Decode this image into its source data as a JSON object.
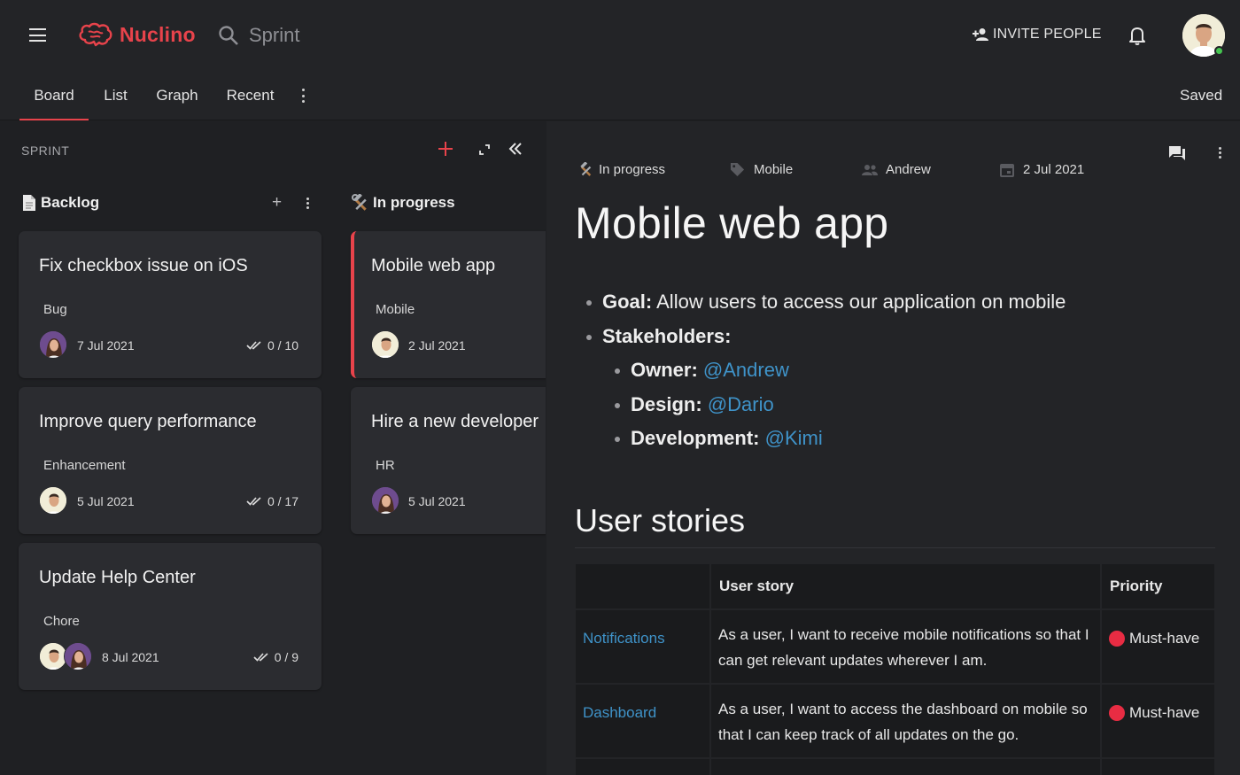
{
  "app": {
    "name": "Nuclino",
    "search_text": "Sprint",
    "invite_label": "INVITE PEOPLE",
    "brand_color": "#e8434b",
    "icons": [
      "menu-icon",
      "brain-logo-icon",
      "search-icon",
      "add-person-icon",
      "bell-icon"
    ]
  },
  "tabs": [
    {
      "label": "Board",
      "active": true
    },
    {
      "label": "List"
    },
    {
      "label": "Graph"
    },
    {
      "label": "Recent"
    }
  ],
  "status": "Saved",
  "board": {
    "label": "SPRINT",
    "columns": [
      {
        "icon": "page-icon",
        "title": "Backlog",
        "cards": [
          {
            "title": "Fix checkbox issue on iOS",
            "tag": "Bug",
            "date": "7 Jul 2021",
            "checks": "0 / 10"
          },
          {
            "title": "Improve query performance",
            "tag": "Enhancement",
            "date": "5 Jul 2021",
            "checks": "0 / 17"
          },
          {
            "title": "Update Help Center",
            "tag": "Chore",
            "date": "8 Jul 2021",
            "checks": "0 / 9"
          }
        ]
      },
      {
        "icon": "hammer-wrench-icon",
        "title": "In progress",
        "cards": [
          {
            "title": "Mobile web app",
            "tag": "Mobile",
            "date": "2 Jul 2021"
          },
          {
            "title": "Hire a new developer",
            "tag": "HR",
            "date": "5 Jul 2021"
          }
        ]
      }
    ]
  },
  "doc": {
    "meta": {
      "status": "In progress",
      "tag": "Mobile",
      "assignee": "Andrew",
      "date": "2 Jul 2021"
    },
    "title": "Mobile web app",
    "goal_label": "Goal:",
    "goal_text": " Allow users to access our application on mobile",
    "stakeholders_label": "Stakeholders:",
    "owner_label": "Owner:",
    "owner": "@Andrew",
    "design_label": "Design:",
    "design": "@Dario",
    "development_label": "Development:",
    "development": "@Kimi",
    "section_title": "User stories",
    "table": {
      "headers": [
        "",
        "User story",
        "Priority"
      ],
      "rows": [
        {
          "name": "Notifications",
          "story": "As a user, I want to receive mobile notifications so that I can get relevant updates wherever I am.",
          "priority": "Must-have"
        },
        {
          "name": "Dashboard",
          "story": "As a user, I want to access the dashboard on mobile so that I can keep track of all updates on the go.",
          "priority": "Must-have"
        }
      ]
    },
    "priority_color": "#e82c43",
    "link_color": "#3f93c9"
  }
}
